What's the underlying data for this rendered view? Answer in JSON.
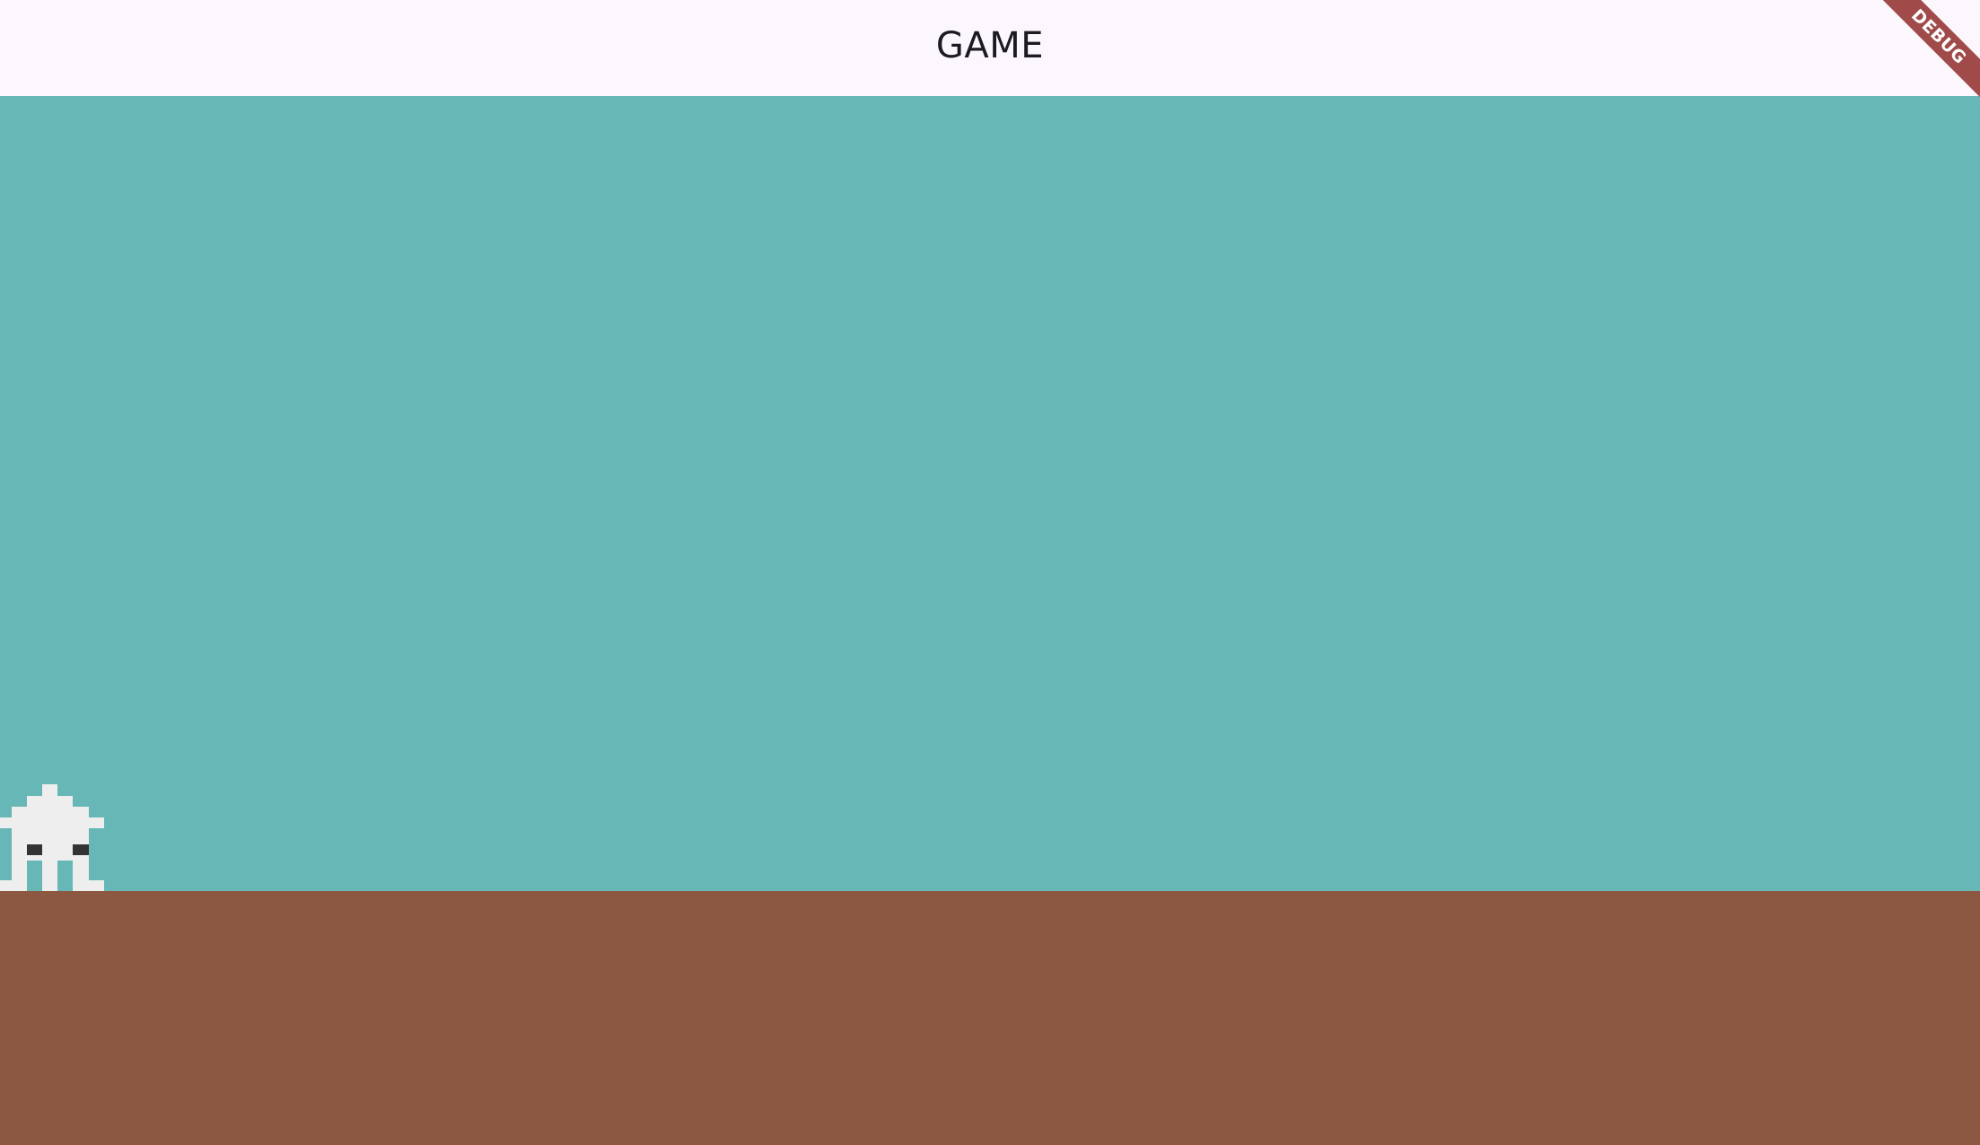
{
  "app_bar": {
    "title": "GAME"
  },
  "debug_banner": {
    "label": "DEBUG"
  },
  "scene": {
    "sky_color": "#67b7b7",
    "ground_color": "#8d5841",
    "character": {
      "name": "pixel-invader-icon",
      "body_color": "#eeeeee",
      "eye_color": "#333333"
    }
  },
  "colors": {
    "app_bar_bg": "#fcf7fd",
    "title_text": "#1c1b1f",
    "debug_ribbon": "#a04a4a"
  }
}
